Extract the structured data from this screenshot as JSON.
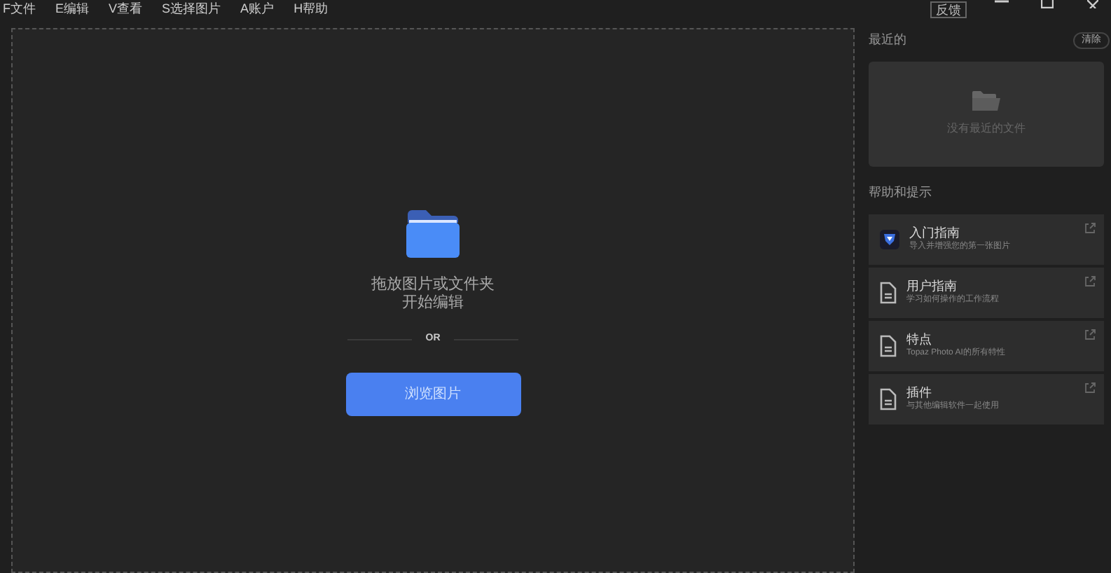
{
  "menu": [
    {
      "label": "F文件"
    },
    {
      "label": "E编辑"
    },
    {
      "label": "V查看"
    },
    {
      "label": "S选择图片"
    },
    {
      "label": "A账户"
    },
    {
      "label": "H帮助"
    }
  ],
  "window_controls": {
    "feedback": "反馈"
  },
  "drop_zone": {
    "lines": [
      "拖放图片或文件夹",
      "开始编辑"
    ],
    "separator": "OR",
    "button": "浏览图片"
  },
  "recent": {
    "title": "最近的",
    "clear": "清除",
    "empty": "没有最近的文件"
  },
  "help": {
    "title": "帮助和提示",
    "items": [
      {
        "kind": "app",
        "title": "入门指南",
        "subtitle": "导入并增强您的第一张图片"
      },
      {
        "kind": "doc",
        "title": "用户指南",
        "subtitle": "学习如何操作的工作流程"
      },
      {
        "kind": "doc",
        "title": "特点",
        "subtitle": "Topaz Photo AI的所有特性"
      },
      {
        "kind": "doc",
        "title": "插件",
        "subtitle": "与其他编辑软件一起使用"
      }
    ]
  }
}
